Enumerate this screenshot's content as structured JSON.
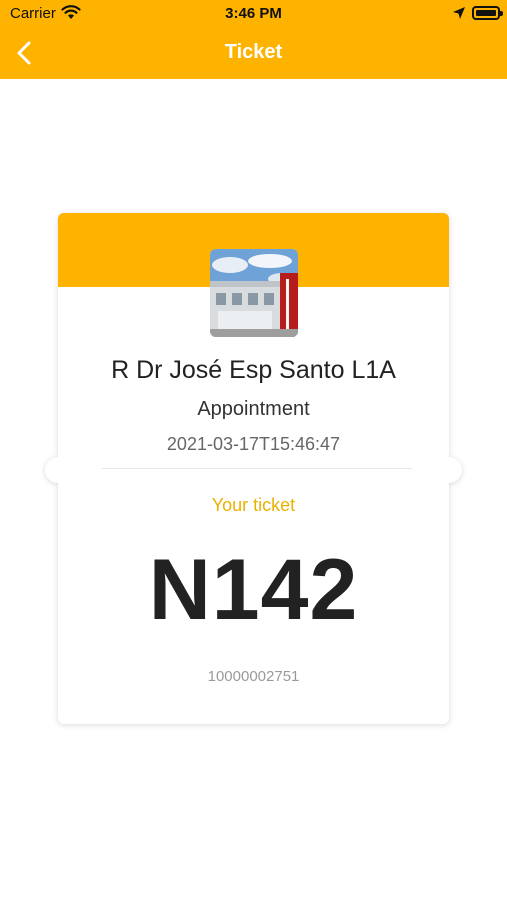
{
  "status_bar": {
    "carrier": "Carrier",
    "time": "3:46 PM",
    "icons": [
      "wifi-icon",
      "location-arrow-icon",
      "battery-icon"
    ]
  },
  "nav": {
    "back_icon": "chevron-left-icon",
    "title": "Ticket"
  },
  "ticket": {
    "photo": "building-photo",
    "place_name": "R Dr José Esp Santo L1A",
    "service": "Appointment",
    "datetime": "2021-03-17T15:46:47",
    "your_ticket_label": "Your ticket",
    "number": "N142",
    "code": "10000002751"
  },
  "colors": {
    "accent": "#FDB300",
    "accent_text": "#EAB200",
    "text_dark": "#222222",
    "text_muted": "#9A9A9A"
  }
}
